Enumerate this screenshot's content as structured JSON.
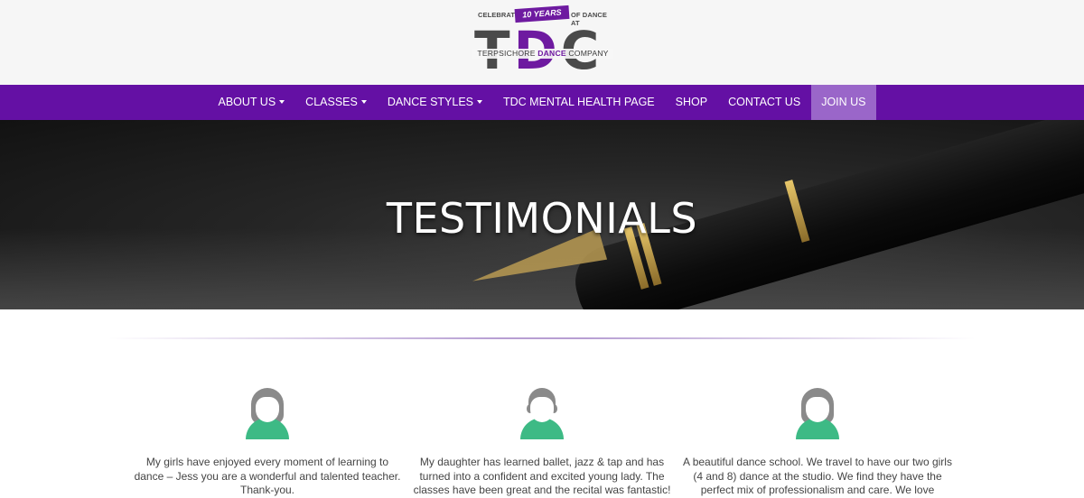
{
  "logo": {
    "celebrating": "CELEBRATING",
    "years": "10 YEARS",
    "of_dance_at": "OF DANCE AT",
    "letters": [
      "T",
      "D",
      "C"
    ],
    "sub_left": "TERPSICHORE",
    "sub_mid": "DANCE",
    "sub_right": "COMPANY"
  },
  "nav": {
    "items": [
      {
        "label": "ABOUT US",
        "dropdown": true
      },
      {
        "label": "CLASSES",
        "dropdown": true
      },
      {
        "label": "DANCE STYLES",
        "dropdown": true
      },
      {
        "label": "TDC MENTAL HEALTH PAGE",
        "dropdown": false
      },
      {
        "label": "SHOP",
        "dropdown": false
      },
      {
        "label": "CONTACT US",
        "dropdown": false
      },
      {
        "label": "JOIN US",
        "dropdown": false,
        "active": true
      }
    ]
  },
  "hero": {
    "title": "TESTIMONIALS"
  },
  "testimonials": [
    {
      "avatar": "female-user-icon",
      "text": "My girls have enjoyed every moment of learning to dance – Jess you are a wonderful and talented teacher. Thank-you."
    },
    {
      "avatar": "male-user-icon",
      "text": "My daughter has learned ballet, jazz & tap and has turned into a confident and excited young lady. The classes have been great and the recital was fantastic!"
    },
    {
      "avatar": "female-user-icon",
      "text": "A beautiful dance school. We travel to have our two girls (4 and 8) dance at the studio. We find they have the perfect mix of professionalism and care. We love"
    }
  ],
  "colors": {
    "brand_purple": "#6410a4",
    "nav_active": "#9a66c9",
    "avatar_green": "#3dba85",
    "avatar_grey": "#8a8a8a"
  }
}
